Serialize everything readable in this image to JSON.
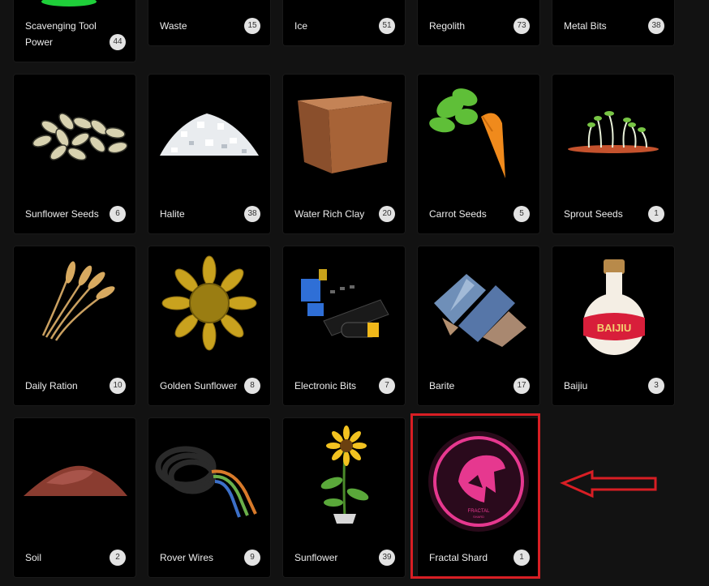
{
  "items": [
    {
      "name": "Scavenging Tool Power",
      "count": "44"
    },
    {
      "name": "Waste",
      "count": "15"
    },
    {
      "name": "Ice",
      "count": "51"
    },
    {
      "name": "Regolith",
      "count": "73"
    },
    {
      "name": "Metal Bits",
      "count": "38"
    },
    {
      "name": "Sunflower Seeds",
      "count": "6"
    },
    {
      "name": "Halite",
      "count": "38"
    },
    {
      "name": "Water Rich Clay",
      "count": "20"
    },
    {
      "name": "Carrot Seeds",
      "count": "5"
    },
    {
      "name": "Sprout Seeds",
      "count": "1"
    },
    {
      "name": "Daily Ration",
      "count": "10"
    },
    {
      "name": "Golden Sunflower",
      "count": "8"
    },
    {
      "name": "Electronic Bits",
      "count": "7"
    },
    {
      "name": "Barite",
      "count": "17"
    },
    {
      "name": "Baijiu",
      "count": "3"
    },
    {
      "name": "Soil",
      "count": "2"
    },
    {
      "name": "Rover Wires",
      "count": "9"
    },
    {
      "name": "Sunflower",
      "count": "39"
    },
    {
      "name": "Fractal Shard",
      "count": "1"
    }
  ],
  "icons": {
    "scavenging": "scavenging-tool-icon",
    "waste": "waste-icon",
    "ice": "ice-icon",
    "regolith": "regolith-icon",
    "metal": "metal-bits-icon",
    "sunflower_seeds": "sunflower-seeds-icon",
    "halite": "halite-icon",
    "clay": "clay-block-icon",
    "carrot": "carrot-icon",
    "sprout": "sprout-icon",
    "wheat": "wheat-bundle-icon",
    "golden_sunflower": "golden-sunflower-icon",
    "electronics": "electronic-bits-icon",
    "barite": "barite-crystal-icon",
    "baijiu": "baijiu-bottle-icon",
    "soil": "soil-pile-icon",
    "wires": "wire-coil-icon",
    "sunflower": "potted-sunflower-icon",
    "fractal": "fractal-shard-logo-icon"
  },
  "baijiu_label": "BAIJIU",
  "fractal_logo": {
    "top": "FRACTAL",
    "bottom": "SHARD"
  },
  "colors": {
    "highlight": "#d81e24",
    "fractal_pink": "#e6388f",
    "card_bg": "#000000",
    "page_bg": "#121212"
  }
}
